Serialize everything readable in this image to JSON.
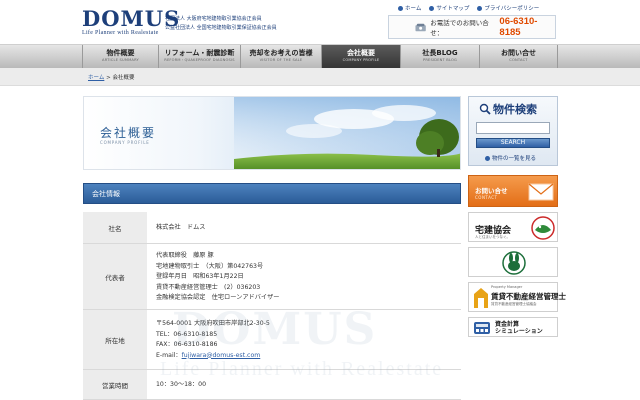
{
  "header": {
    "logo": "DOMUS",
    "tagline": "Life Planner with Realestate",
    "assoc_line1": "社団法人 大阪府宅地建物取引業協会正会員",
    "assoc_line2": "公益社団法人 全国宅地建物取引業保証協会正会員",
    "top_links": [
      {
        "label": "ホーム",
        "icon": "dot-icon"
      },
      {
        "label": "サイトマップ",
        "icon": "dot-icon"
      },
      {
        "label": "プライバシーポリシー",
        "icon": "dot-icon"
      }
    ],
    "phone_label": "お電話でのお問い合せ：",
    "phone_number": "06-6310-8185"
  },
  "nav": {
    "items": [
      {
        "label": "物件概要",
        "sub": "ARTICLE SUMMARY"
      },
      {
        "label": "リフォーム・耐震診断",
        "sub": "REFORM・QUAKEPROOF DIAGNOSIS"
      },
      {
        "label": "売却をお考えの皆様",
        "sub": "VISITOR OF THE SALE"
      },
      {
        "label": "会社概要",
        "sub": "COMPANY PROFILE"
      },
      {
        "label": "社長BLOG",
        "sub": "PRESIDENT BLOG"
      },
      {
        "label": "お問い合せ",
        "sub": "CONTACT"
      }
    ],
    "active_index": 3
  },
  "breadcrumb": {
    "home": "ホーム",
    "separator": ">",
    "current": "会社概要"
  },
  "page_banner": {
    "title": "会社概要",
    "subtitle": "COMPANY PROFILE"
  },
  "section": {
    "title": "会社情報"
  },
  "table": {
    "rows": [
      {
        "label": "社名",
        "lines": [
          "株式会社　ドムス"
        ]
      },
      {
        "label": "代表者",
        "lines": [
          "代表取締役　藤原 豚",
          "宅地建物取引士　（大阪）第042763号",
          "登録年月日　昭和63年1月22日",
          "賃貸不動産経営管理士　(2）036203",
          "金融検定協会認定　住宅ローンアドバイザー"
        ]
      },
      {
        "label": "所在地",
        "lines": [
          "〒564-0001 大阪府吹田市岸部北2-30-5",
          "TEL：06-6310-8185",
          "FAX：06-6310-8186"
        ],
        "email_prefix": "E-mail：",
        "email": "fujiwara@domus-est.com"
      },
      {
        "label": "営業時間",
        "lines": [
          "10：30～18：00"
        ]
      }
    ]
  },
  "watermark": {
    "text": "DOMUS",
    "sub": "Life Planner with Realestate"
  },
  "sidebar": {
    "search_title": "物件検索",
    "search_value": "",
    "search_button": "SEARCH",
    "search_list_link": "物件の一覧を見る",
    "contact_label": "お問い合せ",
    "contact_sub": "CONTACT",
    "takken_label": "宅建協会",
    "takken_sub": "人と住まいをつなぐ。",
    "takken_logo_text": "Hato Mark",
    "chintai_top": "Property Manager",
    "chintai_label": "賃貸不動産経営管理士",
    "chintai_sub": "賃貸不動産経営管理士協議会",
    "shisan_label_1": "資金計算",
    "shisan_label_2": "シミュレーション"
  },
  "colors": {
    "brand_navy": "#1d3f7a",
    "phone_orange": "#e04a00",
    "section_blue": "#2b5c98",
    "contact_orange": "#e36e17"
  }
}
